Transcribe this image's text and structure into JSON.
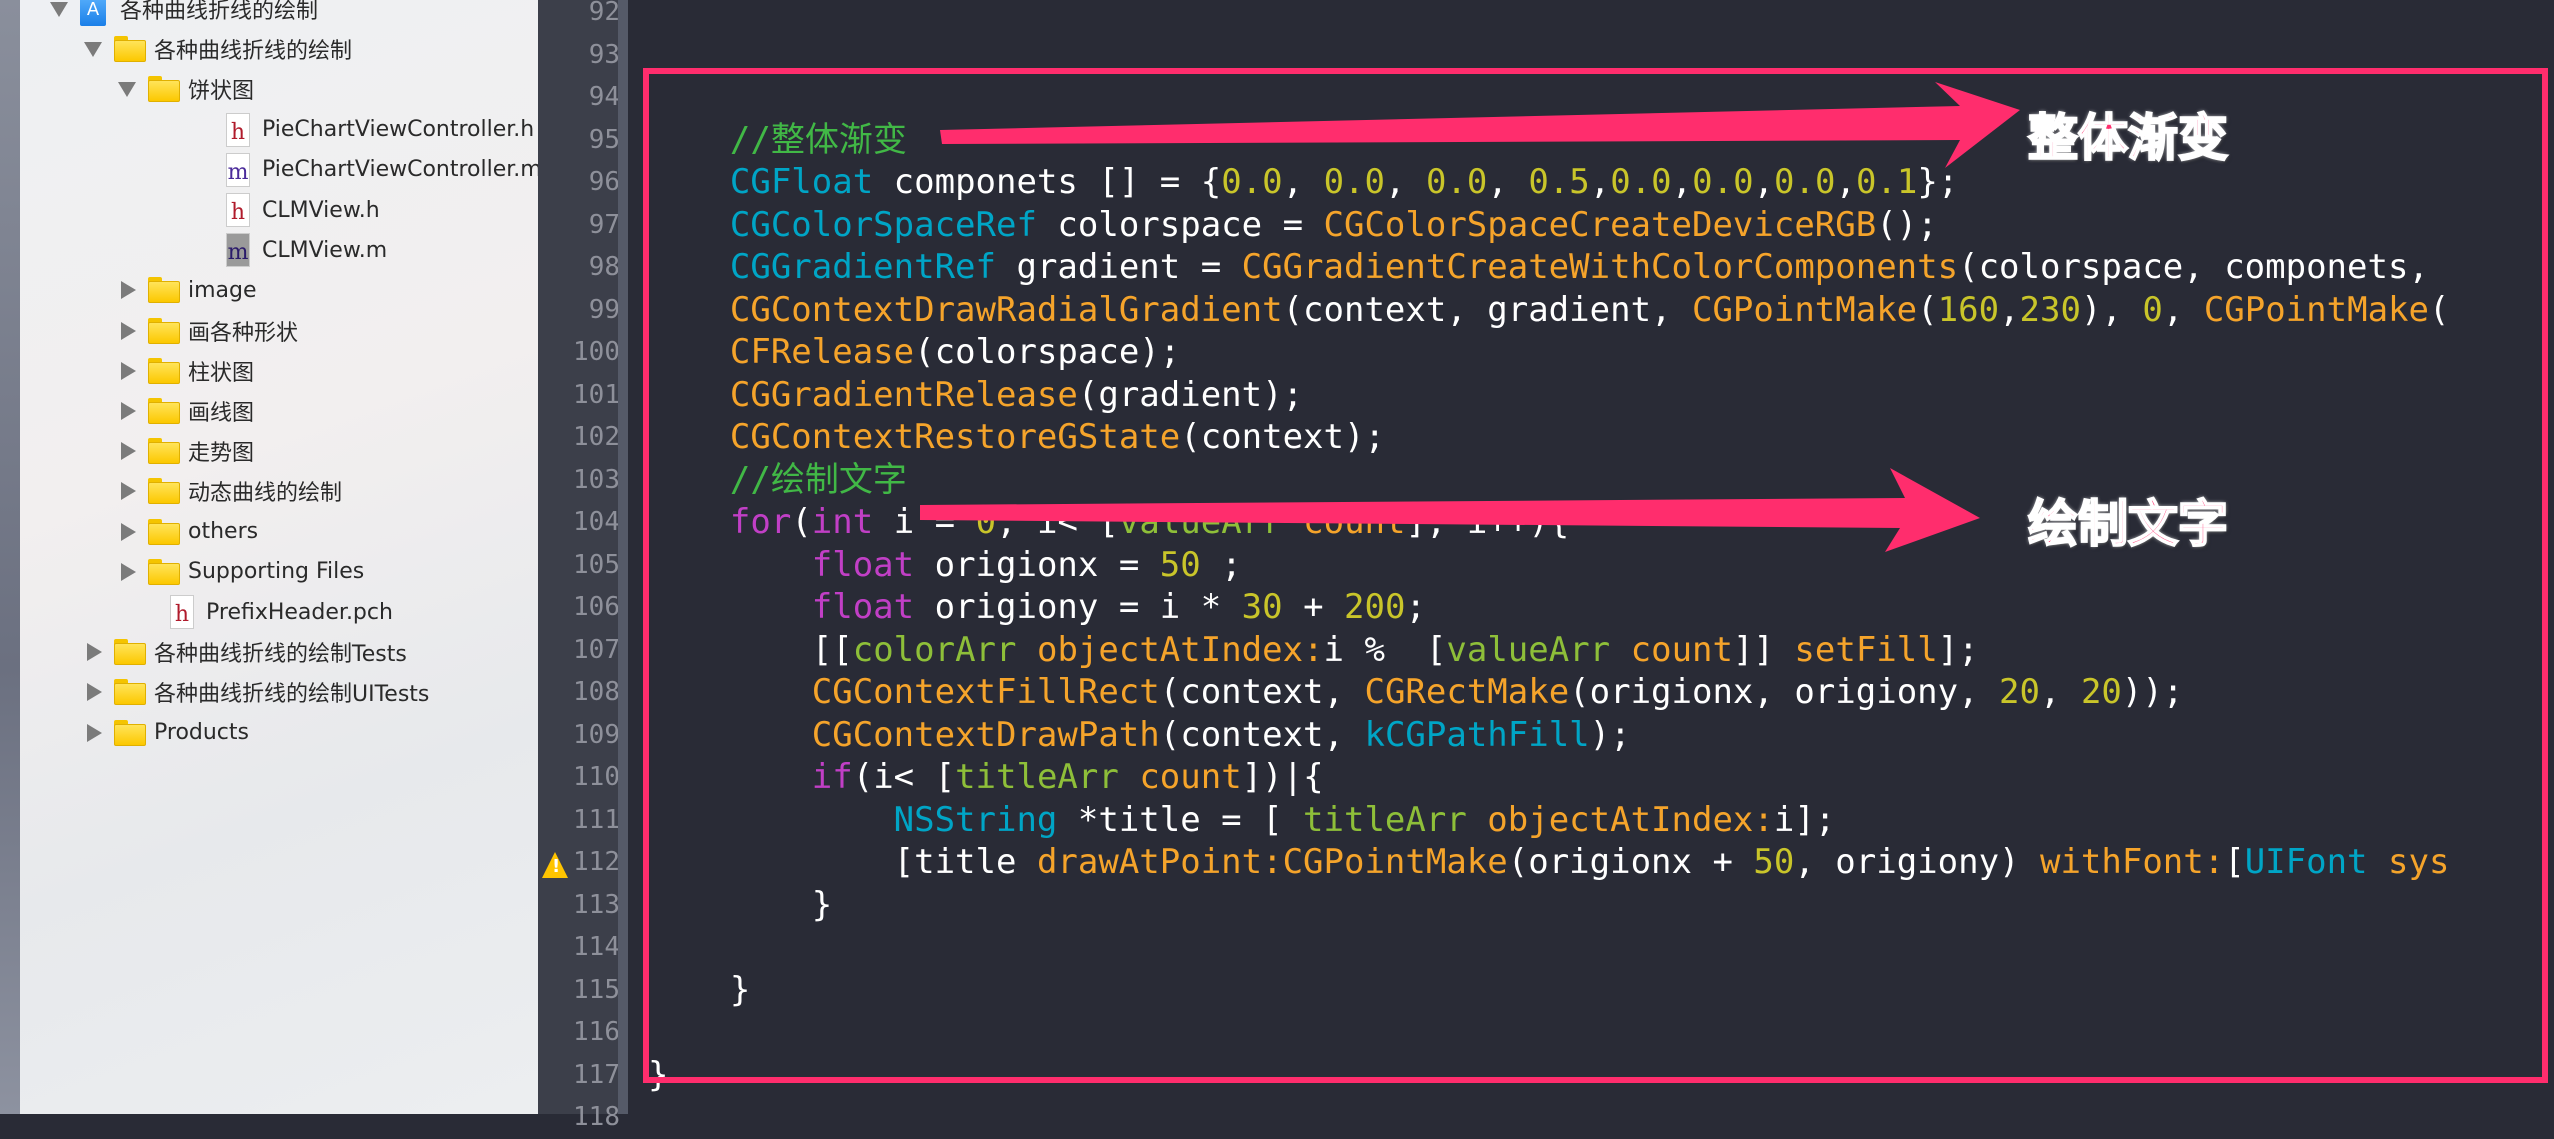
{
  "navigator": {
    "items": [
      {
        "label": "各种曲线折线的绘制",
        "kind": "project",
        "depth": 0,
        "disclosure": "open"
      },
      {
        "label": "各种曲线折线的绘制",
        "kind": "folder",
        "depth": 1,
        "disclosure": "open"
      },
      {
        "label": "饼状图",
        "kind": "folder",
        "depth": 2,
        "disclosure": "open"
      },
      {
        "label": "PieChartViewController.h",
        "kind": "file-h",
        "depth": 3,
        "disclosure": "none"
      },
      {
        "label": "PieChartViewController.m",
        "kind": "file-m",
        "depth": 3,
        "disclosure": "none"
      },
      {
        "label": "CLMView.h",
        "kind": "file-h",
        "depth": 3,
        "disclosure": "none"
      },
      {
        "label": "CLMView.m",
        "kind": "file-m-selected",
        "depth": 3,
        "disclosure": "none"
      },
      {
        "label": "image",
        "kind": "folder",
        "depth": 2,
        "disclosure": "closed"
      },
      {
        "label": "画各种形状",
        "kind": "folder",
        "depth": 2,
        "disclosure": "closed"
      },
      {
        "label": "柱状图",
        "kind": "folder",
        "depth": 2,
        "disclosure": "closed"
      },
      {
        "label": "画线图",
        "kind": "folder",
        "depth": 2,
        "disclosure": "closed"
      },
      {
        "label": "走势图",
        "kind": "folder",
        "depth": 2,
        "disclosure": "closed"
      },
      {
        "label": " 动态曲线的绘制",
        "kind": "folder",
        "depth": 2,
        "disclosure": "closed"
      },
      {
        "label": "others",
        "kind": "folder",
        "depth": 2,
        "disclosure": "closed"
      },
      {
        "label": "Supporting Files",
        "kind": "folder",
        "depth": 2,
        "disclosure": "closed"
      },
      {
        "label": "PrefixHeader.pch",
        "kind": "file-h",
        "depth": 2,
        "disclosure": "none"
      },
      {
        "label": "各种曲线折线的绘制Tests",
        "kind": "folder",
        "depth": 1,
        "disclosure": "closed"
      },
      {
        "label": "各种曲线折线的绘制UITests",
        "kind": "folder",
        "depth": 1,
        "disclosure": "closed"
      },
      {
        "label": "Products",
        "kind": "folder",
        "depth": 1,
        "disclosure": "closed"
      }
    ]
  },
  "editor": {
    "warning_line": 112,
    "lines": [
      {
        "n": "92",
        "indent": 0,
        "tokens": []
      },
      {
        "n": "93",
        "indent": 0,
        "tokens": []
      },
      {
        "n": "94",
        "indent": 0,
        "tokens": []
      },
      {
        "n": "95",
        "indent": 1,
        "tokens": [
          [
            "com",
            "//整体渐变"
          ]
        ]
      },
      {
        "n": "96",
        "indent": 1,
        "tokens": [
          [
            "type",
            "CGFloat"
          ],
          [
            "plain",
            " componets [] = {"
          ],
          [
            "num",
            "0.0"
          ],
          [
            "plain",
            ", "
          ],
          [
            "num",
            "0.0"
          ],
          [
            "plain",
            ", "
          ],
          [
            "num",
            "0.0"
          ],
          [
            "plain",
            ", "
          ],
          [
            "num",
            "0.5"
          ],
          [
            "plain",
            ","
          ],
          [
            "num",
            "0.0"
          ],
          [
            "plain",
            ","
          ],
          [
            "num",
            "0.0"
          ],
          [
            "plain",
            ","
          ],
          [
            "num",
            "0.0"
          ],
          [
            "plain",
            ","
          ],
          [
            "num",
            "0.1"
          ],
          [
            "plain",
            "};"
          ]
        ]
      },
      {
        "n": "97",
        "indent": 1,
        "tokens": [
          [
            "type",
            "CGColorSpaceRef"
          ],
          [
            "plain",
            " colorspace = "
          ],
          [
            "fn",
            "CGColorSpaceCreateDeviceRGB"
          ],
          [
            "plain",
            "();"
          ]
        ]
      },
      {
        "n": "98",
        "indent": 1,
        "tokens": [
          [
            "type",
            "CGGradientRef"
          ],
          [
            "plain",
            " gradient = "
          ],
          [
            "fn",
            "CGGradientCreateWithColorComponents"
          ],
          [
            "plain",
            "(colorspace, componets,"
          ]
        ]
      },
      {
        "n": "99",
        "indent": 1,
        "tokens": [
          [
            "fn",
            "CGContextDrawRadialGradient"
          ],
          [
            "plain",
            "(context, gradient, "
          ],
          [
            "fn",
            "CGPointMake"
          ],
          [
            "plain",
            "("
          ],
          [
            "num",
            "160"
          ],
          [
            "plain",
            ","
          ],
          [
            "num",
            "230"
          ],
          [
            "plain",
            "), "
          ],
          [
            "num",
            "0"
          ],
          [
            "plain",
            ", "
          ],
          [
            "fn",
            "CGPointMake"
          ],
          [
            "plain",
            "("
          ]
        ]
      },
      {
        "n": "100",
        "indent": 1,
        "tokens": [
          [
            "fn",
            "CFRelease"
          ],
          [
            "plain",
            "(colorspace);"
          ]
        ]
      },
      {
        "n": "101",
        "indent": 1,
        "tokens": [
          [
            "fn",
            "CGGradientRelease"
          ],
          [
            "plain",
            "(gradient);"
          ]
        ]
      },
      {
        "n": "102",
        "indent": 1,
        "tokens": [
          [
            "fn",
            "CGContextRestoreGState"
          ],
          [
            "plain",
            "(context);"
          ]
        ]
      },
      {
        "n": "103",
        "indent": 1,
        "tokens": [
          [
            "com",
            "//绘制文字"
          ]
        ]
      },
      {
        "n": "104",
        "indent": 1,
        "tokens": [
          [
            "kw",
            "for"
          ],
          [
            "plain",
            "("
          ],
          [
            "kw",
            "int"
          ],
          [
            "plain",
            " i = "
          ],
          [
            "num",
            "0"
          ],
          [
            "plain",
            "; i< ["
          ],
          [
            "var",
            "valueArr"
          ],
          [
            "plain",
            " "
          ],
          [
            "fn",
            "count"
          ],
          [
            "plain",
            "]; i++){"
          ]
        ]
      },
      {
        "n": "105",
        "indent": 2,
        "tokens": [
          [
            "kw",
            "float"
          ],
          [
            "plain",
            " origionx = "
          ],
          [
            "num",
            "50"
          ],
          [
            "plain",
            " ;"
          ]
        ]
      },
      {
        "n": "106",
        "indent": 2,
        "tokens": [
          [
            "kw",
            "float"
          ],
          [
            "plain",
            " origiony = i * "
          ],
          [
            "num",
            "30"
          ],
          [
            "plain",
            " + "
          ],
          [
            "num",
            "200"
          ],
          [
            "plain",
            ";"
          ]
        ]
      },
      {
        "n": "107",
        "indent": 2,
        "tokens": [
          [
            "plain",
            "[["
          ],
          [
            "var",
            "colorArr"
          ],
          [
            "plain",
            " "
          ],
          [
            "fn",
            "objectAtIndex:"
          ],
          [
            "plain",
            "i %  ["
          ],
          [
            "var",
            "valueArr"
          ],
          [
            "plain",
            " "
          ],
          [
            "fn",
            "count"
          ],
          [
            "plain",
            "]] "
          ],
          [
            "fn",
            "setFill"
          ],
          [
            "plain",
            "];"
          ]
        ]
      },
      {
        "n": "108",
        "indent": 2,
        "tokens": [
          [
            "fn",
            "CGContextFillRect"
          ],
          [
            "plain",
            "(context, "
          ],
          [
            "fn",
            "CGRectMake"
          ],
          [
            "plain",
            "(origionx, origiony, "
          ],
          [
            "num",
            "20"
          ],
          [
            "plain",
            ", "
          ],
          [
            "num",
            "20"
          ],
          [
            "plain",
            "));"
          ]
        ]
      },
      {
        "n": "109",
        "indent": 2,
        "tokens": [
          [
            "fn",
            "CGContextDrawPath"
          ],
          [
            "plain",
            "(context, "
          ],
          [
            "type",
            "kCGPathFill"
          ],
          [
            "plain",
            ");"
          ]
        ]
      },
      {
        "n": "110",
        "indent": 2,
        "tokens": [
          [
            "kw",
            "if"
          ],
          [
            "plain",
            "(i< ["
          ],
          [
            "var",
            "titleArr"
          ],
          [
            "plain",
            " "
          ],
          [
            "fn",
            "count"
          ],
          [
            "plain",
            "])|{"
          ]
        ]
      },
      {
        "n": "111",
        "indent": 3,
        "tokens": [
          [
            "type",
            "NSString"
          ],
          [
            "plain",
            " *title = [ "
          ],
          [
            "var",
            "titleArr"
          ],
          [
            "plain",
            " "
          ],
          [
            "fn",
            "objectAtIndex:"
          ],
          [
            "plain",
            "i];"
          ]
        ]
      },
      {
        "n": "112",
        "indent": 3,
        "tokens": [
          [
            "plain",
            "[title "
          ],
          [
            "fn",
            "drawAtPoint:"
          ],
          [
            "fn",
            "CGPointMake"
          ],
          [
            "plain",
            "(origionx + "
          ],
          [
            "num",
            "50"
          ],
          [
            "plain",
            ", origiony) "
          ],
          [
            "fn",
            "withFont:"
          ],
          [
            "plain",
            "["
          ],
          [
            "type",
            "UIFont"
          ],
          [
            "plain",
            " "
          ],
          [
            "fn",
            "sys"
          ]
        ]
      },
      {
        "n": "113",
        "indent": 2,
        "tokens": [
          [
            "plain",
            "}"
          ]
        ]
      },
      {
        "n": "114",
        "indent": 0,
        "tokens": []
      },
      {
        "n": "115",
        "indent": 1,
        "tokens": [
          [
            "plain",
            "}"
          ]
        ]
      },
      {
        "n": "116",
        "indent": 0,
        "tokens": []
      },
      {
        "n": "117",
        "indent": 0,
        "tokens": [
          [
            "plain",
            "}"
          ]
        ]
      },
      {
        "n": "118",
        "indent": 0,
        "tokens": []
      }
    ]
  },
  "annotations": {
    "gradient_note": "整体渐变",
    "text_note": "绘制文字",
    "color": "#ff2d6d"
  },
  "colors": {
    "keyword": "#c13fc6",
    "type": "#00a5c6",
    "function": "#f5a42b",
    "number": "#c9c52a",
    "comment": "#41b846",
    "variable": "#8ebf39",
    "editor_bg": "#292b36"
  }
}
